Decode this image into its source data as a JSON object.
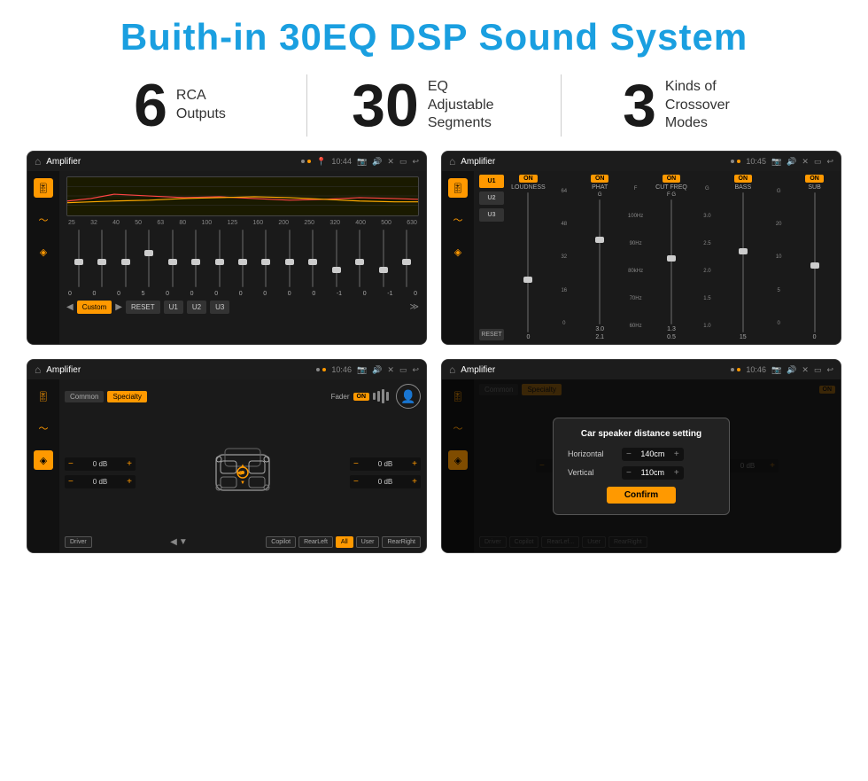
{
  "header": {
    "title": "Buith-in 30EQ DSP Sound System"
  },
  "stats": [
    {
      "number": "6",
      "label_line1": "RCA",
      "label_line2": "Outputs"
    },
    {
      "number": "30",
      "label_line1": "EQ Adjustable",
      "label_line2": "Segments"
    },
    {
      "number": "3",
      "label_line1": "Kinds of",
      "label_line2": "Crossover Modes"
    }
  ],
  "screens": [
    {
      "id": "eq-screen",
      "statusbar": {
        "app": "Amplifier",
        "time": "10:44"
      },
      "eq": {
        "freqs": [
          "25",
          "32",
          "40",
          "50",
          "63",
          "80",
          "100",
          "125",
          "160",
          "200",
          "250",
          "320",
          "400",
          "500",
          "630"
        ],
        "values": [
          "0",
          "0",
          "0",
          "5",
          "0",
          "0",
          "0",
          "0",
          "0",
          "0",
          "0",
          "-1",
          "0",
          "-1"
        ],
        "preset": "Custom",
        "buttons": [
          "RESET",
          "U1",
          "U2",
          "U3"
        ]
      }
    },
    {
      "id": "crossover-screen",
      "statusbar": {
        "app": "Amplifier",
        "time": "10:45"
      },
      "presets": [
        "U1",
        "U2",
        "U3"
      ],
      "channels": [
        "LOUDNESS",
        "PHAT",
        "CUT FREQ",
        "BASS",
        "SUB"
      ]
    },
    {
      "id": "speaker-screen",
      "statusbar": {
        "app": "Amplifier",
        "time": "10:46"
      },
      "buttons": [
        "Common",
        "Specialty"
      ],
      "fader": "Fader",
      "faderOn": "ON",
      "speaker_values": [
        "0 dB",
        "0 dB",
        "0 dB",
        "0 dB"
      ],
      "nav_buttons": [
        "Driver",
        "Copilot",
        "RearLeft",
        "All",
        "User",
        "RearRight"
      ]
    },
    {
      "id": "dialog-screen",
      "statusbar": {
        "app": "Amplifier",
        "time": "10:46"
      },
      "dialog": {
        "title": "Car speaker distance setting",
        "horizontal_label": "Horizontal",
        "horizontal_value": "140cm",
        "vertical_label": "Vertical",
        "vertical_value": "110cm",
        "confirm_label": "Confirm"
      }
    }
  ],
  "colors": {
    "accent": "#f90",
    "blue": "#1a9fe0",
    "dark_bg": "#1a1a1a",
    "text_light": "#cccccc"
  }
}
